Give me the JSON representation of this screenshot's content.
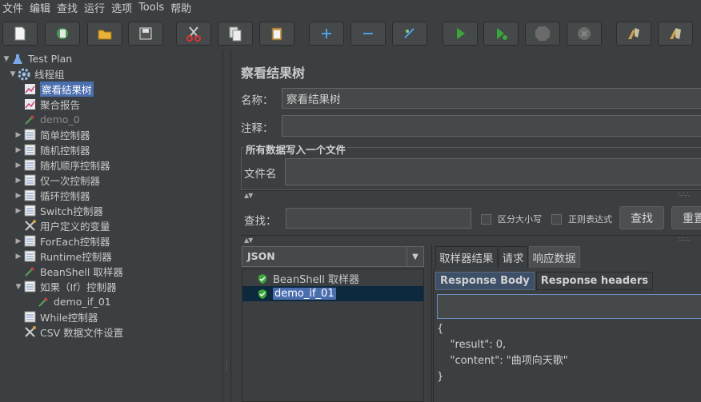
{
  "menu": [
    "文件",
    "编辑",
    "查找",
    "运行",
    "选项",
    "Tools",
    "帮助"
  ],
  "toolbar": [
    "new-icon",
    "templates-icon",
    "open-icon",
    "save-icon",
    "cut-icon",
    "copy-icon",
    "paste-icon",
    "expand-icon",
    "collapse-icon",
    "toggle-icon",
    "start-icon",
    "start-no-pause-icon",
    "stop-icon",
    "shutdown-icon",
    "clear-icon",
    "clear-all-icon"
  ],
  "tree": {
    "root": "Test Plan",
    "thread_group": "线程组",
    "items": [
      {
        "label": "察看结果树",
        "icon": "chart-icon",
        "selected": true
      },
      {
        "label": "聚合报告",
        "icon": "chart-icon"
      },
      {
        "label": "demo_0",
        "icon": "pipette-icon",
        "dim": true
      },
      {
        "label": "简单控制器",
        "icon": "controller-icon",
        "expandable": true
      },
      {
        "label": "随机控制器",
        "icon": "controller-icon",
        "expandable": true
      },
      {
        "label": "随机顺序控制器",
        "icon": "controller-icon",
        "expandable": true
      },
      {
        "label": "仅一次控制器",
        "icon": "controller-icon",
        "expandable": true
      },
      {
        "label": "循环控制器",
        "icon": "controller-icon",
        "expandable": true
      },
      {
        "label": "Switch控制器",
        "icon": "controller-icon",
        "expandable": true
      },
      {
        "label": "用户定义的变量",
        "icon": "wrench-icon"
      },
      {
        "label": "ForEach控制器",
        "icon": "controller-icon",
        "expandable": true
      },
      {
        "label": "Runtime控制器",
        "icon": "controller-icon",
        "expandable": true
      },
      {
        "label": "BeanShell 取样器",
        "icon": "pipette-icon"
      },
      {
        "label": "如果（If）控制器",
        "icon": "controller-icon",
        "expanded": true
      },
      {
        "label": "demo_if_01",
        "icon": "pipette-icon",
        "child": true
      },
      {
        "label": "While控制器",
        "icon": "controller-icon"
      },
      {
        "label": "CSV 数据文件设置",
        "icon": "wrench-icon"
      }
    ]
  },
  "panel": {
    "title": "察看结果树",
    "name_label": "名称：",
    "name_value": "察看结果树",
    "comment_label": "注释：",
    "comment_value": "",
    "file_group_title": "所有数据写入一个文件",
    "filename_label": "文件名",
    "filename_value": "",
    "search_label": "查找：",
    "search_value": "",
    "case_label": "区分大小写",
    "regex_label": "正则表达式",
    "search_button": "查找",
    "reset_button": "重置",
    "renderer": "JSON",
    "results": [
      {
        "label": "BeanShell 取样器",
        "selected": false
      },
      {
        "label": "demo_if_01",
        "selected": true
      }
    ],
    "tabs": [
      "取样器结果",
      "请求",
      "响应数据"
    ],
    "active_tab": 2,
    "subtabs": [
      "Response Body",
      "Response headers"
    ],
    "active_subtab": 0,
    "response_body": "{\n    \"result\": 0,\n    \"content\": \"曲项向天歌\"\n}"
  },
  "colors": {
    "background": "#3c3f41",
    "selection": "#4b6eaf",
    "check_green": "#3ca53c"
  }
}
